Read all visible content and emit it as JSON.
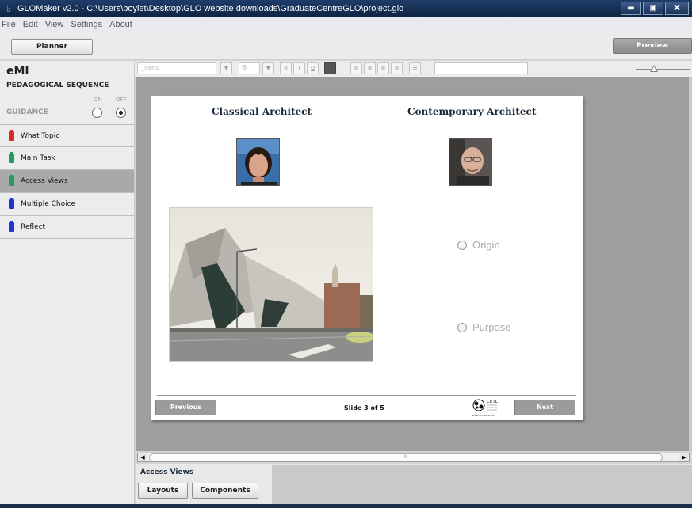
{
  "window": {
    "title": "GLOMaker v2.0 - C:\\Users\\boylet\\Desktop\\GLO website downloads\\GraduateCentreGLO\\project.glo",
    "minimize": "▬",
    "maximize": "▣",
    "close": "X"
  },
  "menu": [
    "File",
    "Edit",
    "View",
    "Settings",
    "About"
  ],
  "toolbar": {
    "planner": "Planner",
    "preview": "Preview"
  },
  "sidebar": {
    "title": "eMI",
    "section": "PEDAGOGICAL SEQUENCE",
    "guidance": {
      "label": "GUIDANCE",
      "on": "ON",
      "off": "OFF",
      "selected": "off"
    },
    "items": [
      {
        "label": "What Topic",
        "color": "#d42a2a",
        "active": false
      },
      {
        "label": "Main Task",
        "color": "#2a9a5a",
        "active": false
      },
      {
        "label": "Access Views",
        "color": "#2a9a5a",
        "active": true
      },
      {
        "label": "Multiple Choice",
        "color": "#2233cc",
        "active": false
      },
      {
        "label": "Reflect",
        "color": "#2233cc",
        "active": false
      }
    ]
  },
  "format": {
    "font": "_sans",
    "size": "8",
    "bold": "B",
    "italic": "I",
    "underline": "U"
  },
  "slide": {
    "left_heading": "Classical Architect",
    "right_heading": "Contemporary Architect",
    "options": [
      "Origin",
      "Purpose"
    ],
    "previous": "Previous",
    "counter": "Slide 3 of 5",
    "next": "Next",
    "logo_text": "CETL",
    "logo_url": "www.rlo-cetl.ac.uk"
  },
  "scroll": {
    "left": "◀",
    "right": "▶",
    "grip": "III"
  },
  "bottom": {
    "label": "Access Views",
    "layouts": "Layouts",
    "components": "Components"
  },
  "colors": {
    "active_item": "#a9a9a9",
    "canvas": "#9e9e9e",
    "titlebar": "#0d2342"
  }
}
